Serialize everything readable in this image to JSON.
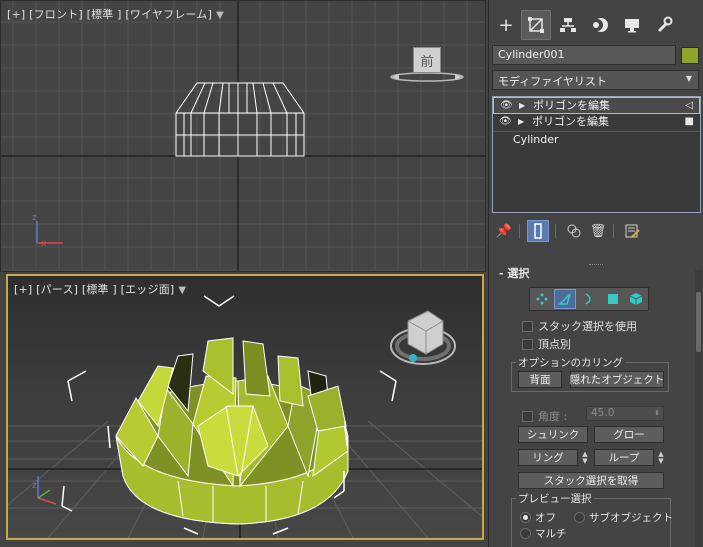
{
  "viewports": {
    "front": {
      "label": "[+] [フロント] [標準 ] [ワイヤフレーム]",
      "viewcube_label": "前"
    },
    "perspective": {
      "label": "[+] [パース] [標準 ] [エッジ面]"
    }
  },
  "command_panel": {
    "tabs": [
      {
        "name": "create",
        "icon": "plus-icon"
      },
      {
        "name": "modify",
        "icon": "modify-icon",
        "active": true
      },
      {
        "name": "hierarchy",
        "icon": "hierarchy-icon"
      },
      {
        "name": "motion",
        "icon": "motion-icon"
      },
      {
        "name": "display",
        "icon": "display-icon"
      },
      {
        "name": "utilities",
        "icon": "wrench-icon"
      }
    ],
    "object_name": "Cylinder001",
    "object_color": "#8ea52a",
    "modifier_list_label": "モディファイヤリスト",
    "stack": [
      {
        "label": "ポリゴンを編集",
        "selected": true
      },
      {
        "label": "ポリゴンを編集",
        "selected": false
      },
      {
        "label": "Cylinder",
        "selected": false
      }
    ],
    "selection_rollout": {
      "title": "選択",
      "use_stack_selection": "スタック選択を使用",
      "by_vertex": "頂点別",
      "culling_group_title": "オプションのカリング",
      "backface_button": "背面",
      "occluded_button": "隠れたオブジェクト",
      "angle_label": "角度 :",
      "angle_value": "45.0",
      "shrink_button": "シュリンク",
      "grow_button": "グロー",
      "ring_button": "リング",
      "loop_button": "ループ",
      "get_stack_selection_button": "スタック選択を取得",
      "preview_group_title": "プレビュー選択",
      "preview_options": [
        "オフ",
        "サブオブジェクト",
        "マルチ"
      ],
      "preview_selected": "オフ"
    }
  },
  "colors": {
    "accent_viewport_border": "#c8a84a",
    "mesh_color": "#a9bf2e",
    "active_tool": "#5a79b0"
  }
}
